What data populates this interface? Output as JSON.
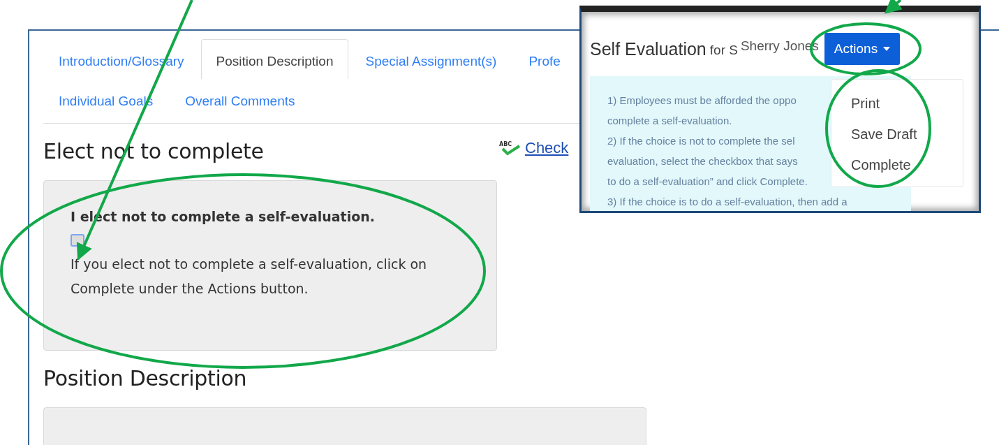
{
  "tabs": [
    {
      "label": "Introduction/Glossary",
      "selected": false
    },
    {
      "label": "Position Description",
      "selected": true
    },
    {
      "label": "Special Assignment(s)",
      "selected": false
    },
    {
      "label": "Profe",
      "selected": false
    },
    {
      "label": "Individual Goals",
      "selected": false
    },
    {
      "label": "Overall Comments",
      "selected": false
    }
  ],
  "spell_check": {
    "icon_text": "ABC",
    "label": "Check"
  },
  "sections": [
    {
      "kind": "elect",
      "heading": "Elect not to complete",
      "title": "I elect not to complete a self-evaluation.",
      "checked": false,
      "note": "If you elect not to complete a self-evaluation, click on Complete under the Actions button."
    },
    {
      "kind": "panel",
      "heading": "Position Description"
    }
  ],
  "inset": {
    "title": "Self Evaluation",
    "title_suffix": "for S",
    "name": "Sherry Jones",
    "actions_button": "Actions",
    "menu": [
      "Print",
      "Save Draft",
      "Complete"
    ],
    "instructions": [
      "1) Employees must be afforded the oppo",
      "complete a self-evaluation.",
      "2) If the choice is not to complete the sel",
      "evaluation, select the checkbox that says",
      "to do a self-evaluation” and click Complete.",
      "3) If the choice is to do a self-evaluation, then add a"
    ]
  }
}
